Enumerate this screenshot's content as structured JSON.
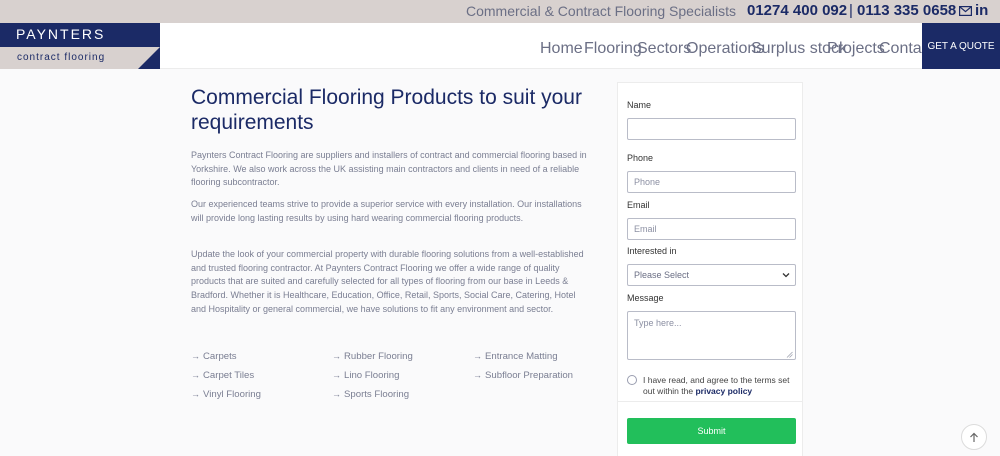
{
  "topbar": {
    "tagline": "Commercial & Contract Flooring Specialists",
    "phone_1": "01274 400 092",
    "separator": "|",
    "phone_2": "0113 335 0658",
    "icons": [
      "mail-icon",
      "linkedin-icon"
    ],
    "linkedin_text": "in"
  },
  "logo": {
    "brand": "PAYNTERS",
    "subtitle": "contract flooring"
  },
  "nav": {
    "items": [
      {
        "label": "Home"
      },
      {
        "label": "Flooring"
      },
      {
        "label": "Sectors"
      },
      {
        "label": "Operations"
      },
      {
        "label": "Surplus stock"
      },
      {
        "label": "Projects"
      },
      {
        "label": "Contact"
      }
    ],
    "cta_label": "GET A QUOTE"
  },
  "main": {
    "title": "Commercial Flooring Products to suit your requirements",
    "paragraphs": [
      "Paynters Contract Flooring are suppliers and installers of contract and commercial flooring based in Yorkshire. We also work across the UK assisting main contractors and clients in need of a reliable flooring subcontractor.",
      "Our experienced teams strive to provide a superior service with every installation. Our installations will provide long lasting results by using hard wearing commercial flooring products.",
      "Update the look of your commercial property with durable flooring solutions from a well-established and trusted flooring contractor. At Paynters Contract Flooring we offer a wide range of quality products that are suited and carefully selected for all types of flooring from our base in Leeds & Bradford. Whether it is Healthcare, Education, Office, Retail, Sports, Social Care, Catering, Hotel and Hospitality or general commercial, we have solutions to fit any environment and sector."
    ],
    "arrow": "→",
    "products": [
      [
        "Carpets",
        "Rubber Flooring",
        "Entrance Matting"
      ],
      [
        "Carpet Tiles",
        "Lino Flooring",
        "Subfloor Preparation"
      ],
      [
        "Vinyl Flooring",
        "Sports Flooring"
      ]
    ]
  },
  "form": {
    "name_label": "Name",
    "name_value": "",
    "phone_label": "Phone",
    "phone_placeholder": "Phone",
    "email_label": "Email",
    "email_placeholder": "Email",
    "interest_label": "Interested in",
    "interest_selected": "Please Select",
    "message_label": "Message",
    "message_placeholder": "Type here...",
    "consent_text": "I have read, and agree to the terms set out within the",
    "privacy_link": "privacy policy",
    "submit_label": "Submit"
  },
  "colors": {
    "brand_navy": "#1b2a66",
    "topbar_bg": "#d8d1cf",
    "submit_green": "#22bf5b"
  }
}
